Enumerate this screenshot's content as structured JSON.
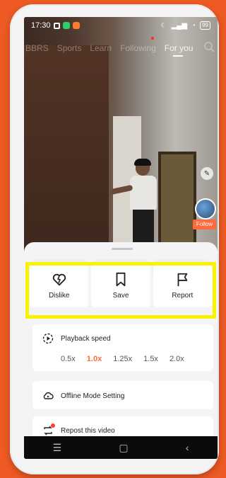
{
  "status_bar": {
    "time": "17:30",
    "battery": "99"
  },
  "top_nav": {
    "items": [
      "BBRS",
      "Sports",
      "Learn",
      "Following",
      "For you"
    ]
  },
  "profile": {
    "follow_label": "Follow"
  },
  "sheet": {
    "actions": [
      {
        "label": "Dislike",
        "icon": "dislike-heart-icon"
      },
      {
        "label": "Save",
        "icon": "bookmark-icon"
      },
      {
        "label": "Report",
        "icon": "flag-icon"
      }
    ],
    "playback": {
      "title": "Playback speed",
      "options": [
        "0.5x",
        "1.0x",
        "1.25x",
        "1.5x",
        "2.0x"
      ],
      "selected": "1.0x",
      "accent": "#ff6a3d"
    },
    "offline_label": "Offline Mode Setting",
    "repost_label": "Repost this video"
  },
  "highlight_color": "#f9f200",
  "nav_bar": {
    "menu": "☰",
    "home": "▢",
    "back": "‹"
  }
}
